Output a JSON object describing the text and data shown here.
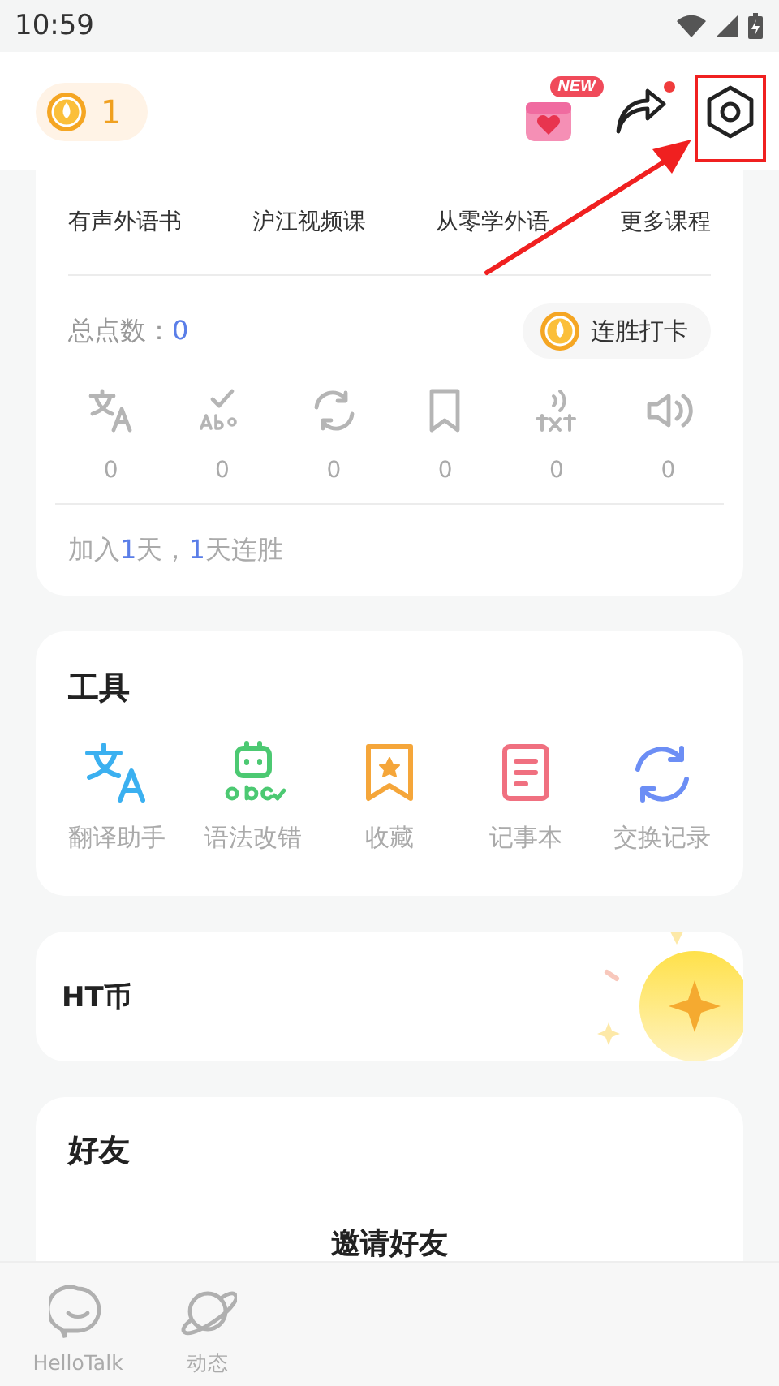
{
  "status_bar": {
    "time": "10:59"
  },
  "header": {
    "streak_count": "1",
    "gift_badge": "NEW",
    "share_notification": true,
    "settings_highlighted": true
  },
  "courses": [
    "有声外语书",
    "沪江视频课",
    "从零学外语",
    "更多课程"
  ],
  "points": {
    "label": "总点数：",
    "value": "0",
    "checkin_button": "连胜打卡"
  },
  "stats": [
    {
      "kind": "translate",
      "count": "0"
    },
    {
      "kind": "grammar",
      "count": "0"
    },
    {
      "kind": "exchange",
      "count": "0"
    },
    {
      "kind": "bookmark",
      "count": "0"
    },
    {
      "kind": "transcript",
      "count": "0"
    },
    {
      "kind": "voice",
      "count": "0"
    }
  ],
  "summary": [
    {
      "text": "加入",
      "highlight": false
    },
    {
      "text": "1",
      "highlight": true
    },
    {
      "text": "天，",
      "highlight": false
    },
    {
      "text": "1",
      "highlight": true
    },
    {
      "text": "天连胜",
      "highlight": false
    }
  ],
  "tools": {
    "title": "工具",
    "items": [
      {
        "kind": "translate",
        "label": "翻译助手"
      },
      {
        "kind": "grammar",
        "label": "语法改错"
      },
      {
        "kind": "bookmark",
        "label": "收藏"
      },
      {
        "kind": "notebook",
        "label": "记事本"
      },
      {
        "kind": "exchange",
        "label": "交换记录"
      }
    ]
  },
  "coins": {
    "title": "HT币"
  },
  "friends": {
    "title": "好友",
    "invite": "邀请好友"
  },
  "nav": [
    {
      "kind": "chat",
      "label": "HelloTalk",
      "selected": false
    },
    {
      "kind": "moments",
      "label": "动态",
      "selected": false
    }
  ]
}
